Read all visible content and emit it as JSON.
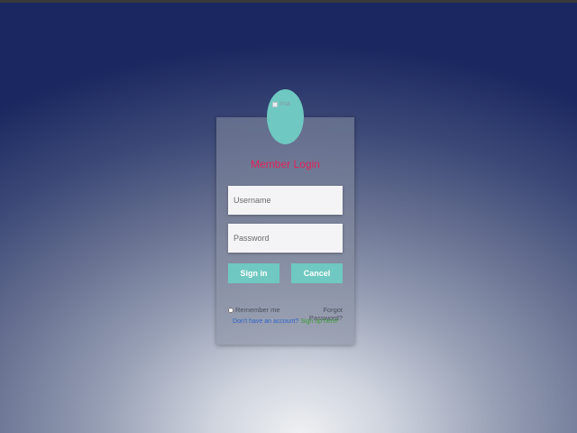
{
  "login": {
    "avatar_alt": "Ima",
    "title": "Member Login",
    "username_placeholder": "Username",
    "password_placeholder": "Password",
    "signin_label": "Sign in",
    "cancel_label": "Cancel",
    "remember_label": "Remember me",
    "remember_checked": false,
    "forgot_label": "Forgot Password?",
    "signup_question": "Don't have an account?",
    "signup_link": "Sign up here!"
  },
  "colors": {
    "accent": "#6fc8c1",
    "title": "#e0245e",
    "signup_question": "#2d63c8",
    "signup_link": "#3f9c3a"
  }
}
